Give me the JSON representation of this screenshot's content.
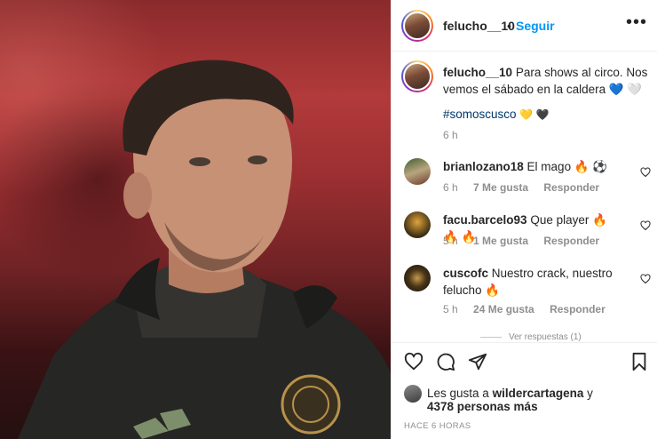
{
  "post": {
    "username": "felucho__10",
    "follow_label": "Seguir",
    "separator": "•",
    "more_label": "•••",
    "caption": "Para shows al circo. Nos vemos el sábado en la caldera 💙 🤍",
    "hashtag": "#somoscusco",
    "hashtag_emojis": "💛 🖤",
    "caption_time": "6 h"
  },
  "comments": [
    {
      "username": "brianlozano18",
      "text": "El mago 🔥 ⚽",
      "time": "6 h",
      "likes": "7 Me gusta",
      "reply": "Responder"
    },
    {
      "username": "facu.barcelo93",
      "text": "Que player 🔥 🔥 🔥",
      "time": "5 h",
      "likes": "1 Me gusta",
      "reply": "Responder"
    },
    {
      "username": "cuscofc",
      "text": "Nuestro crack, nuestro felucho 🔥",
      "time": "5 h",
      "likes": "24 Me gusta",
      "reply": "Responder"
    }
  ],
  "more_replies": "Ver respuestas (1)",
  "likes": {
    "prefix": "Les gusta a",
    "user": "wildercartagena",
    "suffix": "y",
    "count": "4378 personas más"
  },
  "posted_ago": "HACE 6 HORAS"
}
